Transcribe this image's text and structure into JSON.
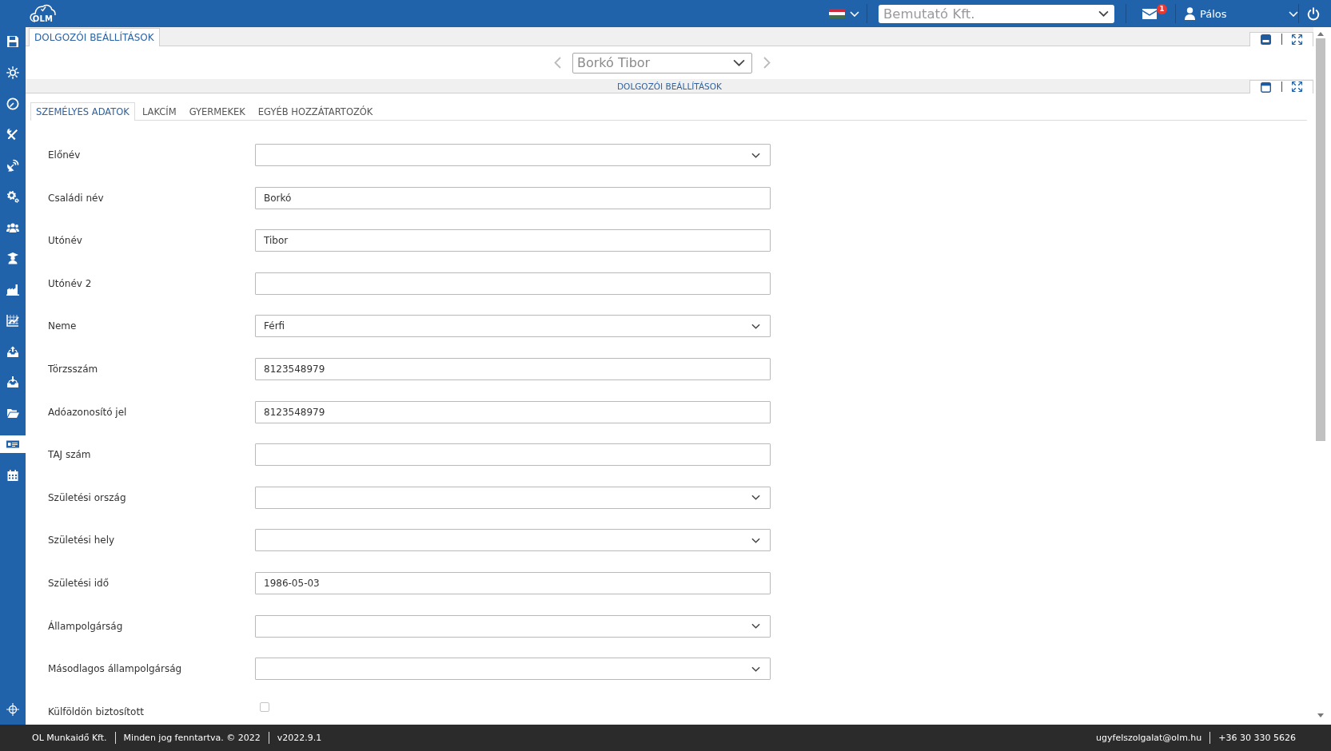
{
  "top_bar": {
    "logo": "OLM",
    "company_select": {
      "value": "Bemutató Kft."
    },
    "messages": {
      "count": "1"
    },
    "user_menu": {
      "name": "Pálos"
    }
  },
  "sidebar": {
    "items": [
      {
        "selected": false
      },
      {
        "selected": false
      },
      {
        "selected": false
      },
      {
        "selected": false
      },
      {
        "selected": false
      },
      {
        "selected": false
      },
      {
        "selected": false
      },
      {
        "selected": false
      },
      {
        "selected": false
      },
      {
        "selected": false
      },
      {
        "selected": false
      },
      {
        "selected": false
      },
      {
        "selected": false
      },
      {
        "selected": true
      },
      {
        "selected": false
      }
    ]
  },
  "window": {
    "tabs": [
      {
        "label": "DOLGOZÓI BEÁLLÍTÁSOK",
        "selected": true
      }
    ],
    "employee_select": {
      "value": "Borkó Tibor"
    },
    "panel": {
      "title": "DOLGOZÓI BEÁLLÍTÁSOK",
      "tabs": [
        {
          "label": "SZEMÉLYES ADATOK",
          "selected": true
        },
        {
          "label": "LAKCÍM",
          "selected": false
        },
        {
          "label": "GYERMEKEK",
          "selected": false
        },
        {
          "label": "EGYÉB HOZZÁTARTOZÓK",
          "selected": false
        }
      ],
      "form": {
        "fields": [
          {
            "label": "Előnév",
            "kind": "select"
          },
          {
            "label": "Családi név",
            "kind": "text",
            "value": "Borkó"
          },
          {
            "label": "Utónév",
            "kind": "text",
            "value": "Tibor"
          },
          {
            "label": "Utónév 2",
            "kind": "text"
          },
          {
            "label": "Neme",
            "kind": "select",
            "value": "Férfi"
          },
          {
            "label": "Törzsszám",
            "kind": "text",
            "value": "8123548979"
          },
          {
            "label": "Adóazonosító jel",
            "kind": "text",
            "value": "8123548979"
          },
          {
            "label": "TAJ szám",
            "kind": "text"
          },
          {
            "label": "Születési ország",
            "kind": "select"
          },
          {
            "label": "Születési hely",
            "kind": "select"
          },
          {
            "label": "Születési idő",
            "kind": "text",
            "value": "1986-05-03"
          },
          {
            "label": "Állampolgárság",
            "kind": "select"
          },
          {
            "label": "Másodlagos állampolgárság",
            "kind": "select"
          },
          {
            "label": "Külföldön biztosított",
            "kind": "checkbox",
            "checked": false
          }
        ]
      }
    }
  },
  "footer": {
    "company": "OL Munkaidő Kft.",
    "copyright": "Minden jog fenntartva. © 2022",
    "version": "v2022.9.1",
    "email": "ugyfelszolgalat@olm.hu",
    "phone": "+36 30 330 5626"
  }
}
